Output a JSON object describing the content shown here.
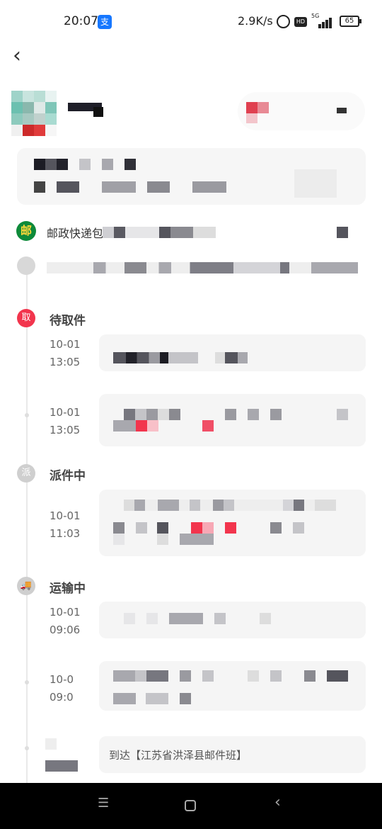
{
  "status_bar": {
    "time": "20:07",
    "pay_icon": "支",
    "network_speed": "2.9K/s",
    "hd": "HD",
    "signal_label": "5G",
    "battery": "65"
  },
  "nav": {
    "back_icon": "‹"
  },
  "carrier": {
    "logo_icon": "post-office-icon",
    "logo_glyph": "邮",
    "name": "邮政快递包"
  },
  "timeline": {
    "stages": [
      {
        "icon_glyph": "取",
        "label": "待取件",
        "active": true
      },
      {
        "icon_glyph": "派",
        "label": "派件中",
        "active": false
      },
      {
        "icon_glyph": "🚚",
        "label": "运输中",
        "active": false
      }
    ],
    "events": [
      {
        "date": "10-01",
        "time": "13:05"
      },
      {
        "date": "10-01",
        "time": "13:05"
      },
      {
        "date": "10-01",
        "time": "11:03"
      },
      {
        "date": "10-01",
        "time": "09:06"
      },
      {
        "date": "10-0",
        "time": "09:0"
      }
    ],
    "last_event_text": "到达【江苏省洪泽县邮件班】"
  },
  "colors": {
    "accent": "#f2354d",
    "card_bg": "#f5f5f5",
    "nav_bar": "#000000"
  },
  "system_nav": {
    "menu_icon": "☰",
    "back_icon": "‹"
  }
}
